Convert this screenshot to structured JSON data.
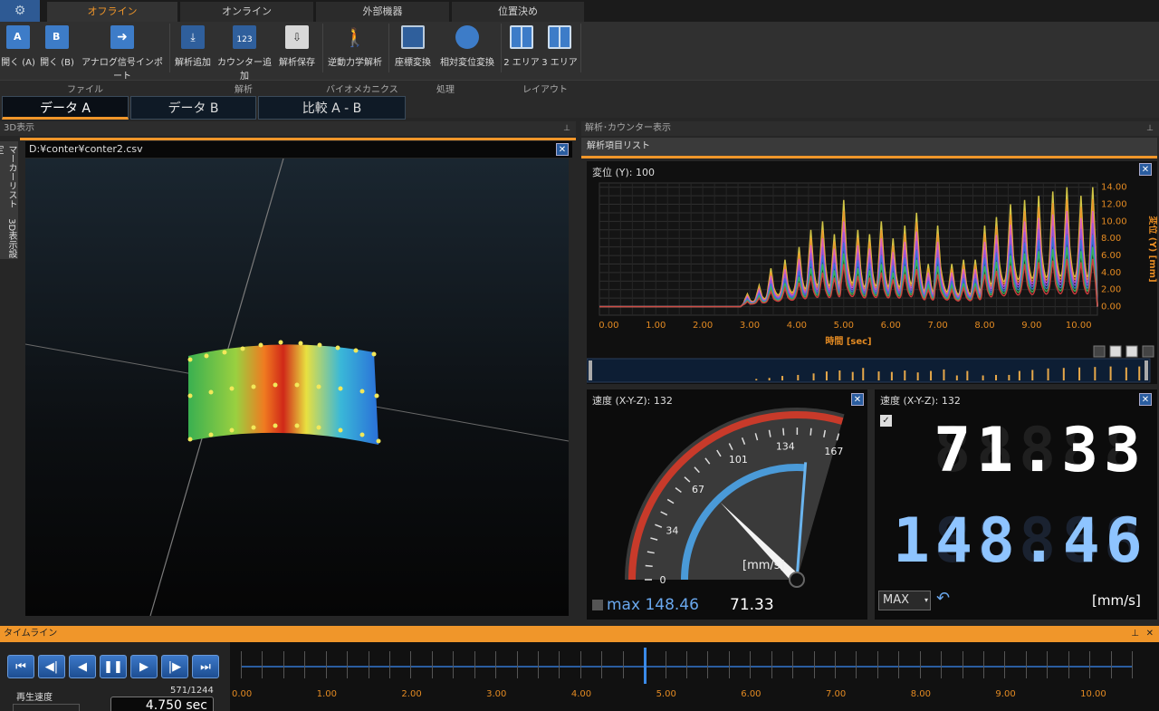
{
  "ribbon_tabs": [
    "オフライン",
    "オンライン",
    "外部機器",
    "位置決め"
  ],
  "ribbon_buttons": {
    "open_a": "開く (A)",
    "open_b": "開く (B)",
    "analog_import": "アナログ信号インポート",
    "add_analysis": "解析追加",
    "add_counter": "カウンター追加",
    "save_analysis": "解析保存",
    "inverse_dynamics": "逆動力学解析",
    "coord_transform": "座標変換",
    "relative_disp": "相対変位変換",
    "area2": "2 エリア",
    "area3": "3 エリア"
  },
  "ribbon_groups": [
    "ファイル",
    "解析",
    "バイオメカニクス",
    "処理",
    "レイアウト"
  ],
  "data_tabs": [
    "データ A",
    "データ B",
    "比較 A - B"
  ],
  "left_panel": {
    "title": "3D表示",
    "file_path": "D:¥conter¥conter2.csv",
    "side_tabs": [
      "マーカーリスト",
      "3D表示設定"
    ]
  },
  "right_panel": {
    "title": "解析･カウンター表示",
    "list_title": "解析項目リスト"
  },
  "chart_panel": {
    "header": "変位 (Y):  100",
    "ylabel": "変位 (Y) [mm]",
    "xlabel": "時間 [sec]"
  },
  "chart_data": {
    "type": "line",
    "xlim": [
      -0.2,
      10.4
    ],
    "ylim": [
      -1,
      14.5
    ],
    "x_ticks": [
      "0.00",
      "1.00",
      "2.00",
      "3.00",
      "4.00",
      "5.00",
      "6.00",
      "7.00",
      "8.00",
      "9.00",
      "10.00"
    ],
    "y_ticks": [
      "0.00",
      "2.00",
      "4.00",
      "6.00",
      "8.00",
      "10.00",
      "12.00",
      "14.00"
    ],
    "series_colors": [
      "#e6d84a",
      "#f0962a",
      "#e060c8",
      "#9a5ae0",
      "#3a78e0",
      "#3ac060",
      "#e04040"
    ],
    "peaks": [
      {
        "x": 2.95,
        "y": 1.5
      },
      {
        "x": 3.2,
        "y": 2.5
      },
      {
        "x": 3.45,
        "y": 4.5
      },
      {
        "x": 3.75,
        "y": 5.5
      },
      {
        "x": 4.05,
        "y": 7.0
      },
      {
        "x": 4.3,
        "y": 9.0
      },
      {
        "x": 4.55,
        "y": 10.0
      },
      {
        "x": 4.8,
        "y": 8.5
      },
      {
        "x": 5.0,
        "y": 12.5
      },
      {
        "x": 5.3,
        "y": 9.0
      },
      {
        "x": 5.55,
        "y": 8.5
      },
      {
        "x": 5.8,
        "y": 10.0
      },
      {
        "x": 6.05,
        "y": 8.0
      },
      {
        "x": 6.3,
        "y": 9.5
      },
      {
        "x": 6.55,
        "y": 11.0
      },
      {
        "x": 6.8,
        "y": 5.0
      },
      {
        "x": 7.0,
        "y": 9.5
      },
      {
        "x": 7.3,
        "y": 5.0
      },
      {
        "x": 7.55,
        "y": 5.5
      },
      {
        "x": 7.8,
        "y": 5.5
      },
      {
        "x": 8.0,
        "y": 9.5
      },
      {
        "x": 8.25,
        "y": 10.5
      },
      {
        "x": 8.55,
        "y": 12.0
      },
      {
        "x": 8.85,
        "y": 12.5
      },
      {
        "x": 9.15,
        "y": 13.0
      },
      {
        "x": 9.45,
        "y": 13.5
      },
      {
        "x": 9.75,
        "y": 14.0
      },
      {
        "x": 10.05,
        "y": 13.0
      },
      {
        "x": 10.3,
        "y": 14.0
      }
    ]
  },
  "gauge_panel": {
    "header": "速度 (X-Y-Z):  132",
    "labels": [
      "0",
      "34",
      "67",
      "101",
      "134",
      "167"
    ],
    "unit": "[mm/s]",
    "max_label": "max 148.46",
    "value": "71.33",
    "max_scale": 167,
    "current": 71.33,
    "max": 148.46
  },
  "digital_panel": {
    "header": "速度 (X-Y-Z):  132",
    "value": "71.33",
    "max_value": "148.46",
    "mode": "MAX",
    "unit": "[mm/s]"
  },
  "timeline": {
    "title": "タイムライン",
    "speed_label": "再生速度",
    "frame_counter": "571/1244",
    "time_display": "4.750 sec",
    "ticks": [
      "0.00",
      "1.00",
      "2.00",
      "3.00",
      "4.00",
      "5.00",
      "6.00",
      "7.00",
      "8.00",
      "9.00",
      "10.00"
    ],
    "position_sec": 4.75
  }
}
